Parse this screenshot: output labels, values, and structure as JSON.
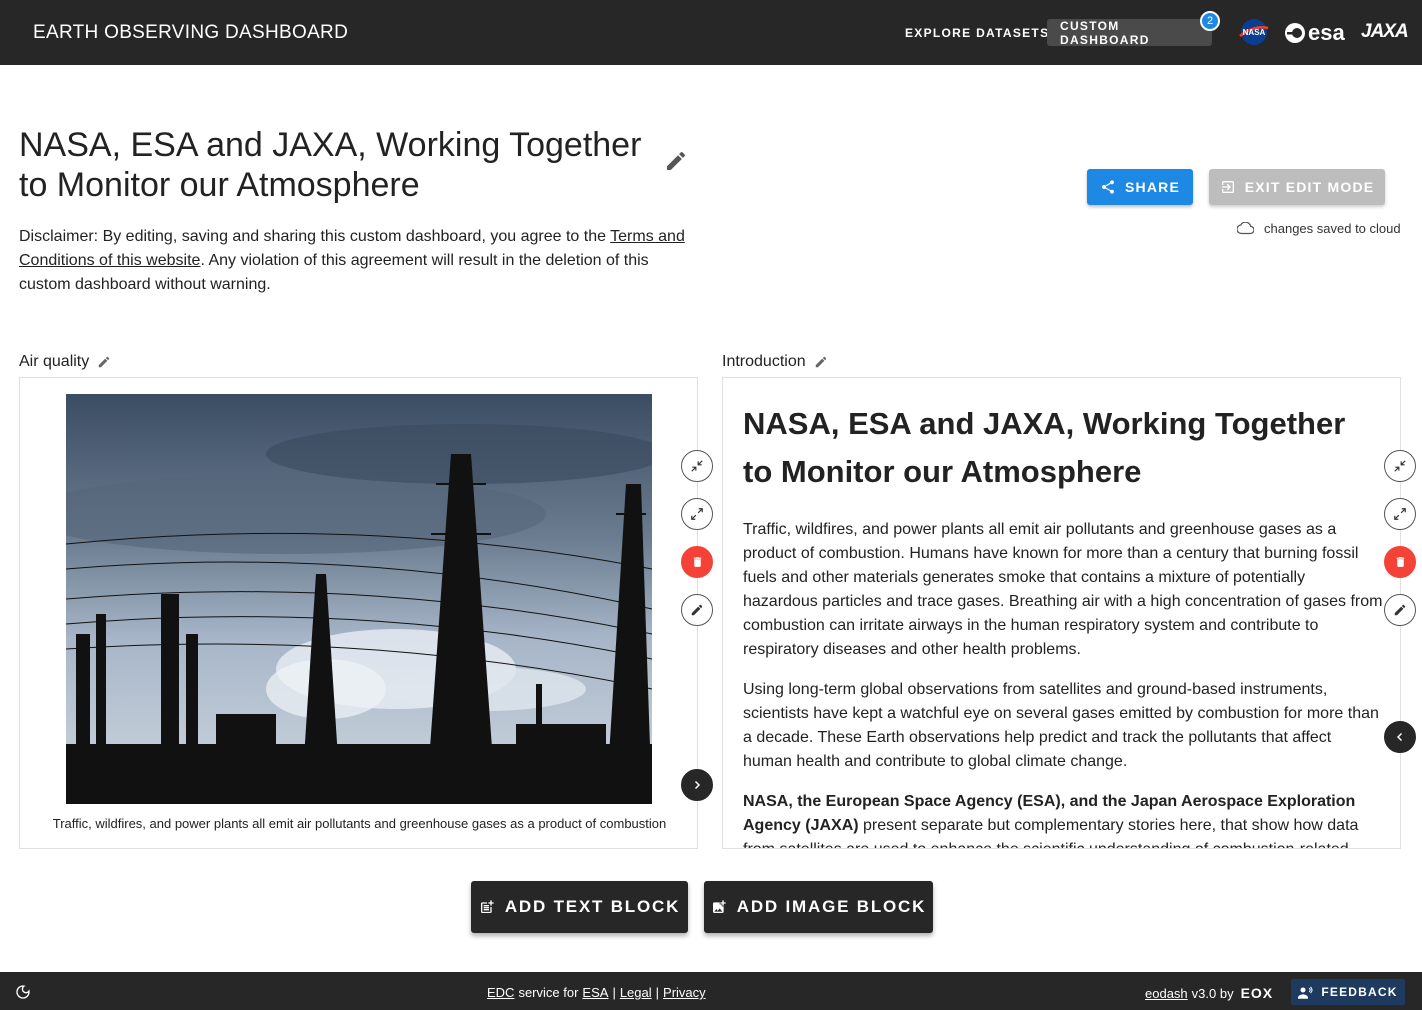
{
  "header": {
    "title": "EARTH OBSERVING DASHBOARD",
    "nav": {
      "explore": "EXPLORE DATASETS",
      "custom": "CUSTOM DASHBOARD",
      "custom_badge": "2"
    },
    "logos": {
      "nasa": "NASA",
      "esa": "esa",
      "jaxa": "JAXA"
    }
  },
  "page": {
    "title": "NASA, ESA and JAXA, Working Together to Monitor our Atmosphere",
    "disclaimer_before": "Disclaimer: By editing, saving and sharing this custom dashboard, you agree to the ",
    "disclaimer_link": "Terms and Conditions of this website",
    "disclaimer_after": ". Any violation of this agreement will result in the deletion of this custom dashboard without warning."
  },
  "actions": {
    "share": "SHARE",
    "exit_edit": "EXIT EDIT MODE",
    "saved_status": "changes saved to cloud"
  },
  "panels": {
    "left": {
      "label": "Air quality",
      "caption": "Traffic, wildfires, and power plants all emit air pollutants and greenhouse gases as a product of combustion"
    },
    "right": {
      "label": "Introduction",
      "heading": "NASA, ESA and JAXA, Working Together to Monitor our Atmosphere",
      "p1": "Traffic, wildfires, and power plants all emit air pollutants and greenhouse gases as a product of combustion. Humans have known for more than a century that burning fossil fuels and other materials generates smoke that contains a mixture of potentially hazardous particles and trace gases. Breathing air with a high concentration of gases from combustion can irritate airways in the human respiratory system and contribute to respiratory diseases and other health problems.",
      "p2": "Using long-term global observations from satellites and ground-based instruments, scientists have kept a watchful eye on several gases emitted by combustion for more than a decade. These Earth observations help predict and track the pollutants that affect human health and contribute to global climate change.",
      "p3_bold": "NASA, the European Space Agency (ESA), and the Japan Aerospace Exploration Agency (JAXA)",
      "p3_rest": " present separate but complementary stories here, that show how data from satellites are used to enhance the scientific understanding of combustion-related trace"
    }
  },
  "add_buttons": {
    "text": "ADD TEXT BLOCK",
    "image": "ADD IMAGE BLOCK"
  },
  "footer": {
    "edc": "EDC",
    "service_for": "service for",
    "esa": "ESA",
    "sep1": "|",
    "legal": "Legal",
    "sep2": "|",
    "privacy": "Privacy",
    "eodash": "eodash",
    "version": "v3.0 by",
    "eox": "EOX",
    "feedback": "FEEDBACK"
  },
  "colors": {
    "bar": "#272727",
    "accent": "#1e88e5",
    "danger": "#f44336"
  }
}
